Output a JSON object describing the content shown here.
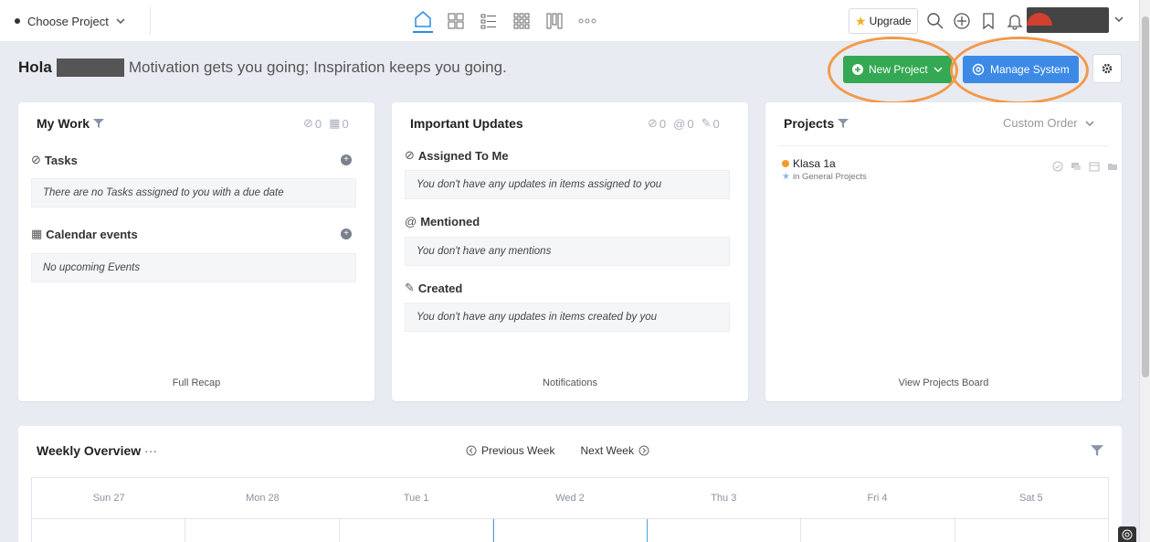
{
  "topbar": {
    "project_select": "Choose Project",
    "upgrade_label": "Upgrade"
  },
  "greeting": {
    "hola": "Hola",
    "motto": "Motivation gets you going; Inspiration keeps you going."
  },
  "actions": {
    "new_project": "New Project",
    "manage_system": "Manage System"
  },
  "my_work": {
    "title": "My Work",
    "count_check": "0",
    "count_cal": "0",
    "tasks_label": "Tasks",
    "tasks_empty": "There are no Tasks assigned to you with a due date",
    "calendar_label": "Calendar events",
    "calendar_empty": "No upcoming Events",
    "footer": "Full Recap"
  },
  "updates": {
    "title": "Important Updates",
    "count_check": "0",
    "count_at": "0",
    "count_pen": "0",
    "assigned_label": "Assigned To Me",
    "assigned_empty": "You don't have any updates in items assigned to you",
    "mentioned_label": "Mentioned",
    "mentioned_empty": "You don't have any mentions",
    "created_label": "Created",
    "created_empty": "You don't have any updates in items created by you",
    "footer": "Notifications"
  },
  "projects": {
    "title": "Projects",
    "order": "Custom Order",
    "item_name": "Klasa 1a",
    "item_sub": "in General Projects",
    "footer": "View Projects Board"
  },
  "weekly": {
    "title": "Weekly Overview",
    "more": "···",
    "prev": "Previous Week",
    "next": "Next Week",
    "days": [
      "Sun 27",
      "Mon 28",
      "Tue 1",
      "Wed 2",
      "Thu 3",
      "Fri 4",
      "Sat 5"
    ]
  },
  "colors": {
    "accent_green": "#34a853",
    "accent_blue": "#3d8ae6",
    "highlight_ring": "#f29a4a",
    "project_dot": "#f2992e"
  }
}
